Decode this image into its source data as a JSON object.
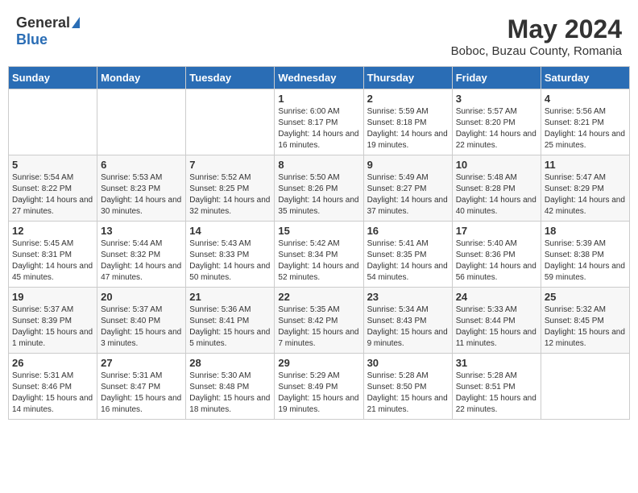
{
  "header": {
    "logo_general": "General",
    "logo_blue": "Blue",
    "title": "May 2024",
    "subtitle": "Boboc, Buzau County, Romania"
  },
  "columns": [
    "Sunday",
    "Monday",
    "Tuesday",
    "Wednesday",
    "Thursday",
    "Friday",
    "Saturday"
  ],
  "weeks": [
    [
      {
        "day": "",
        "info": ""
      },
      {
        "day": "",
        "info": ""
      },
      {
        "day": "",
        "info": ""
      },
      {
        "day": "1",
        "info": "Sunrise: 6:00 AM\nSunset: 8:17 PM\nDaylight: 14 hours and 16 minutes."
      },
      {
        "day": "2",
        "info": "Sunrise: 5:59 AM\nSunset: 8:18 PM\nDaylight: 14 hours and 19 minutes."
      },
      {
        "day": "3",
        "info": "Sunrise: 5:57 AM\nSunset: 8:20 PM\nDaylight: 14 hours and 22 minutes."
      },
      {
        "day": "4",
        "info": "Sunrise: 5:56 AM\nSunset: 8:21 PM\nDaylight: 14 hours and 25 minutes."
      }
    ],
    [
      {
        "day": "5",
        "info": "Sunrise: 5:54 AM\nSunset: 8:22 PM\nDaylight: 14 hours and 27 minutes."
      },
      {
        "day": "6",
        "info": "Sunrise: 5:53 AM\nSunset: 8:23 PM\nDaylight: 14 hours and 30 minutes."
      },
      {
        "day": "7",
        "info": "Sunrise: 5:52 AM\nSunset: 8:25 PM\nDaylight: 14 hours and 32 minutes."
      },
      {
        "day": "8",
        "info": "Sunrise: 5:50 AM\nSunset: 8:26 PM\nDaylight: 14 hours and 35 minutes."
      },
      {
        "day": "9",
        "info": "Sunrise: 5:49 AM\nSunset: 8:27 PM\nDaylight: 14 hours and 37 minutes."
      },
      {
        "day": "10",
        "info": "Sunrise: 5:48 AM\nSunset: 8:28 PM\nDaylight: 14 hours and 40 minutes."
      },
      {
        "day": "11",
        "info": "Sunrise: 5:47 AM\nSunset: 8:29 PM\nDaylight: 14 hours and 42 minutes."
      }
    ],
    [
      {
        "day": "12",
        "info": "Sunrise: 5:45 AM\nSunset: 8:31 PM\nDaylight: 14 hours and 45 minutes."
      },
      {
        "day": "13",
        "info": "Sunrise: 5:44 AM\nSunset: 8:32 PM\nDaylight: 14 hours and 47 minutes."
      },
      {
        "day": "14",
        "info": "Sunrise: 5:43 AM\nSunset: 8:33 PM\nDaylight: 14 hours and 50 minutes."
      },
      {
        "day": "15",
        "info": "Sunrise: 5:42 AM\nSunset: 8:34 PM\nDaylight: 14 hours and 52 minutes."
      },
      {
        "day": "16",
        "info": "Sunrise: 5:41 AM\nSunset: 8:35 PM\nDaylight: 14 hours and 54 minutes."
      },
      {
        "day": "17",
        "info": "Sunrise: 5:40 AM\nSunset: 8:36 PM\nDaylight: 14 hours and 56 minutes."
      },
      {
        "day": "18",
        "info": "Sunrise: 5:39 AM\nSunset: 8:38 PM\nDaylight: 14 hours and 59 minutes."
      }
    ],
    [
      {
        "day": "19",
        "info": "Sunrise: 5:37 AM\nSunset: 8:39 PM\nDaylight: 15 hours and 1 minute."
      },
      {
        "day": "20",
        "info": "Sunrise: 5:37 AM\nSunset: 8:40 PM\nDaylight: 15 hours and 3 minutes."
      },
      {
        "day": "21",
        "info": "Sunrise: 5:36 AM\nSunset: 8:41 PM\nDaylight: 15 hours and 5 minutes."
      },
      {
        "day": "22",
        "info": "Sunrise: 5:35 AM\nSunset: 8:42 PM\nDaylight: 15 hours and 7 minutes."
      },
      {
        "day": "23",
        "info": "Sunrise: 5:34 AM\nSunset: 8:43 PM\nDaylight: 15 hours and 9 minutes."
      },
      {
        "day": "24",
        "info": "Sunrise: 5:33 AM\nSunset: 8:44 PM\nDaylight: 15 hours and 11 minutes."
      },
      {
        "day": "25",
        "info": "Sunrise: 5:32 AM\nSunset: 8:45 PM\nDaylight: 15 hours and 12 minutes."
      }
    ],
    [
      {
        "day": "26",
        "info": "Sunrise: 5:31 AM\nSunset: 8:46 PM\nDaylight: 15 hours and 14 minutes."
      },
      {
        "day": "27",
        "info": "Sunrise: 5:31 AM\nSunset: 8:47 PM\nDaylight: 15 hours and 16 minutes."
      },
      {
        "day": "28",
        "info": "Sunrise: 5:30 AM\nSunset: 8:48 PM\nDaylight: 15 hours and 18 minutes."
      },
      {
        "day": "29",
        "info": "Sunrise: 5:29 AM\nSunset: 8:49 PM\nDaylight: 15 hours and 19 minutes."
      },
      {
        "day": "30",
        "info": "Sunrise: 5:28 AM\nSunset: 8:50 PM\nDaylight: 15 hours and 21 minutes."
      },
      {
        "day": "31",
        "info": "Sunrise: 5:28 AM\nSunset: 8:51 PM\nDaylight: 15 hours and 22 minutes."
      },
      {
        "day": "",
        "info": ""
      }
    ]
  ]
}
